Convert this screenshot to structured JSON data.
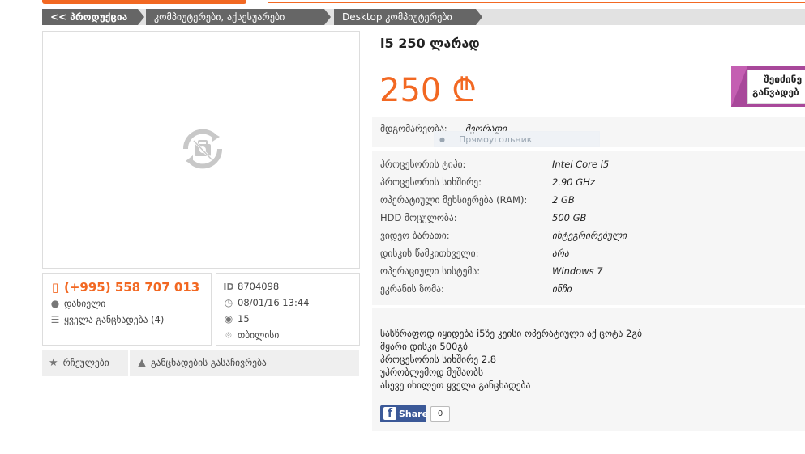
{
  "breadcrumb": {
    "items": [
      "<< პროდუქცია",
      "კომპიუტერები, აქსესუარები",
      "Desktop კომპიუტერები"
    ]
  },
  "contact": {
    "phone": "(+995) 558 707 013",
    "name": "დანიელი",
    "all_ads": "ყველა განცხადება (4)"
  },
  "meta": {
    "id_label": "ID",
    "id": "8704098",
    "date": "08/01/16 13:44",
    "views": "15",
    "city": "თბილისი"
  },
  "actions": {
    "favorites": "რჩეულები",
    "report": "განცხადების გასაჩივრება"
  },
  "listing": {
    "title": "i5 250 ლარად",
    "price": "250 ₾",
    "condition_label": "მდგომარეობა:",
    "condition_value": "მეორადი"
  },
  "banner": {
    "line1": "შეიძინე",
    "line2": "განვადებ"
  },
  "tooltip": {
    "text": "Прямоугольник"
  },
  "specs": [
    {
      "key": "პროცესორის ტიპი:",
      "value": "Intel Core i5"
    },
    {
      "key": "პროცესორის სიხშირე:",
      "value": "2.90 GHz"
    },
    {
      "key": "ოპერატიული მეხსიერება (RAM):",
      "value": "2 GB"
    },
    {
      "key": "HDD მოცულობა:",
      "value": "500 GB"
    },
    {
      "key": "ვიდეო ბარათი:",
      "value": "ინტეგრირებული"
    },
    {
      "key": "დისკის წამკითხველი:",
      "value": "არა"
    },
    {
      "key": "ოპერაციული სისტემა:",
      "value": "Windows 7"
    },
    {
      "key": "ეკრანის ზომა:",
      "value": "ინჩი"
    }
  ],
  "description": [
    "სასწრაფოდ იყიდება i5ზე კეისი ოპერატიული აქ ცოტა 2გბ",
    "მყარი დისკი 500გბ",
    "პროცესორის სიხშირე 2.8",
    "უპრობლემოდ მუშაობს",
    "ასევე იხილეთ ყველა განცხადება"
  ],
  "share": {
    "label": "Share",
    "count": "0"
  },
  "colors": {
    "accent": "#f26822",
    "facebook": "#3b5998",
    "banner": "#a8489a"
  }
}
